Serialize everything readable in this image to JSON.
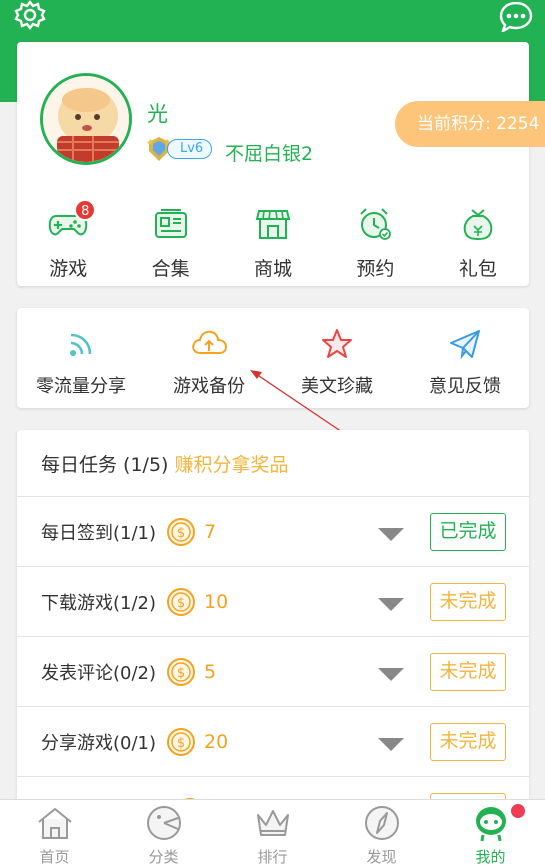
{
  "header": {
    "settings_icon": "gear-icon",
    "message_icon": "chat-bubble-icon",
    "color": "#23b253"
  },
  "profile": {
    "username": "光",
    "level": "Lv6",
    "title": "不屈白银2",
    "points_label": "当前积分: 2254"
  },
  "quick_actions": [
    {
      "label": "游戏",
      "icon": "gamepad-icon",
      "badge": "8"
    },
    {
      "label": "合集",
      "icon": "collection-icon"
    },
    {
      "label": "商城",
      "icon": "shop-icon"
    },
    {
      "label": "预约",
      "icon": "alarm-clock-icon"
    },
    {
      "label": "礼包",
      "icon": "gift-bag-icon"
    }
  ],
  "tools": [
    {
      "label": "零流量分享",
      "icon": "wifi-share-icon",
      "color": "#4fc3c8"
    },
    {
      "label": "游戏备份",
      "icon": "cloud-upload-icon",
      "color": "#f3a321"
    },
    {
      "label": "美文珍藏",
      "icon": "star-icon",
      "color": "#ee4444"
    },
    {
      "label": "意见反馈",
      "icon": "paper-plane-icon",
      "color": "#3b9be0"
    }
  ],
  "tasks": {
    "title": "每日任务 (1/5)",
    "subtitle": "赚积分拿奖品",
    "items": [
      {
        "name": "每日签到(1/1)",
        "points": "7",
        "status": "已完成",
        "done": true
      },
      {
        "name": "下载游戏(1/2)",
        "points": "10",
        "status": "未完成",
        "done": false
      },
      {
        "name": "发表评论(0/2)",
        "points": "5",
        "status": "未完成",
        "done": false
      },
      {
        "name": "分享游戏(0/1)",
        "points": "20",
        "status": "未完成",
        "done": false
      }
    ]
  },
  "bottom_nav": [
    {
      "label": "首页",
      "icon": "home-icon"
    },
    {
      "label": "分类",
      "icon": "category-icon"
    },
    {
      "label": "排行",
      "icon": "crown-icon"
    },
    {
      "label": "发现",
      "icon": "compass-icon"
    },
    {
      "label": "我的",
      "icon": "profile-robot-icon",
      "active": true
    }
  ],
  "colors": {
    "primary": "#23b253",
    "accent": "#f3b53c",
    "points_pill": "#fcc57a",
    "badge": "#e53935"
  }
}
